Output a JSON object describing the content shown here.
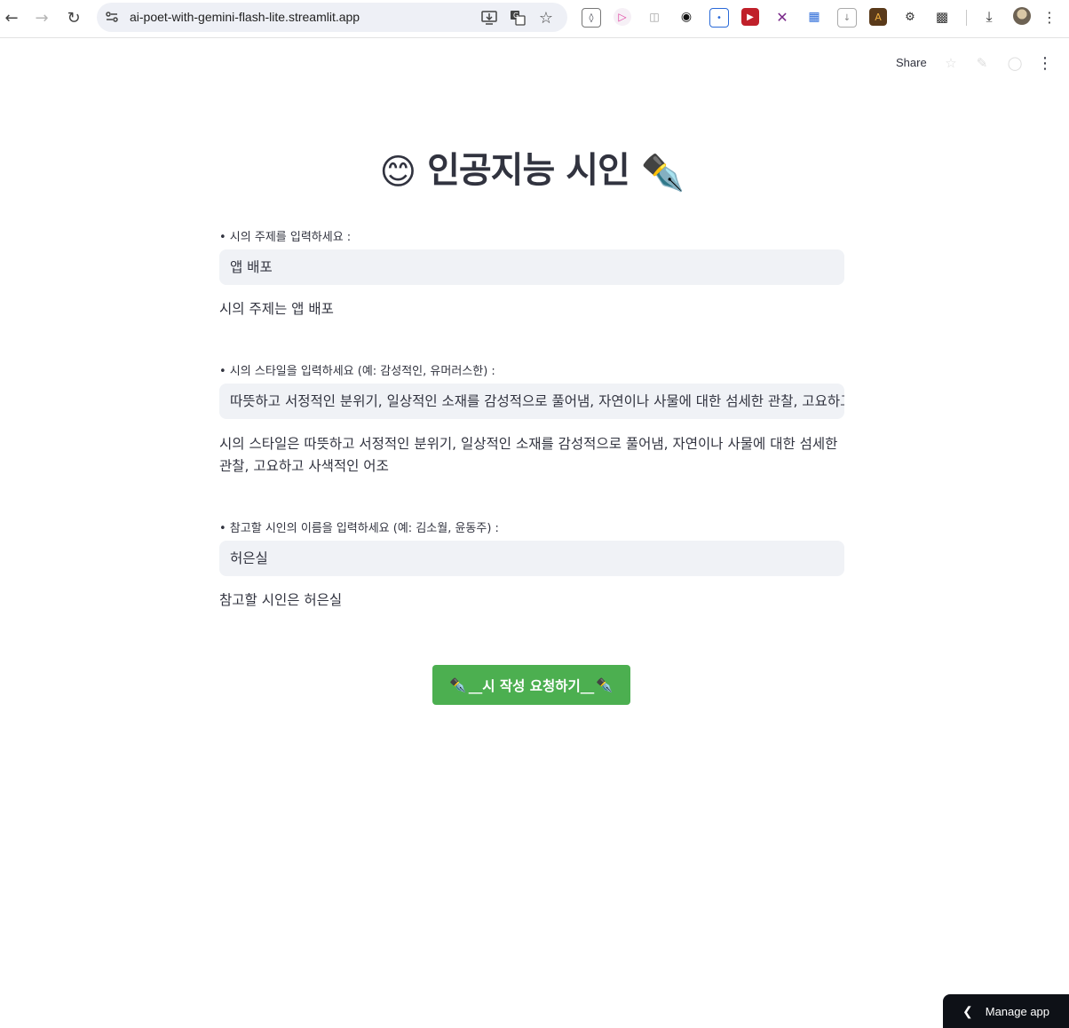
{
  "browser": {
    "url": "ai-poet-with-gemini-flash-lite.streamlit.app",
    "toolbar_icons": [
      "back-icon",
      "forward-icon",
      "reload-icon",
      "site-info-icon",
      "install-app-icon",
      "translate-icon",
      "bookmark-star-icon",
      "extensions-icon",
      "downloads-icon",
      "profile-avatar",
      "menu-icon"
    ]
  },
  "header": {
    "share_label": "Share"
  },
  "page": {
    "title": "인공지능 시인",
    "title_emoji_left": "😊",
    "title_emoji_right": "✒️",
    "topic": {
      "label": "• 시의 주제를 입력하세요 :",
      "value": "앱 배포",
      "echo": "시의 주제는 앱 배포"
    },
    "style": {
      "label": "• 시의 스타일을 입력하세요 (예: 감성적인, 유머러스한) :",
      "value": "따뜻하고 서정적인 분위기, 일상적인 소재를 감성적으로 풀어냄, 자연이나 사물에 대한 섬세한 관찰, 고요하고 사색적인 어조",
      "echo": "시의 스타일은 따뜻하고 서정적인 분위기, 일상적인 소재를 감성적으로 풀어냄, 자연이나 사물에 대한 섬세한 관찰, 고요하고 사색적인 어조"
    },
    "poet": {
      "label": "• 참고할 시인의 이름을 입력하세요 (예: 김소월, 윤동주) :",
      "value": "허은실",
      "echo": "참고할 시인은 허은실"
    },
    "submit_label": "__시 작성 요청하기__"
  },
  "footer": {
    "manage_label": "Manage app"
  },
  "colors": {
    "button": "#4caf50",
    "input_bg": "#f0f2f6",
    "text": "#31333f"
  }
}
